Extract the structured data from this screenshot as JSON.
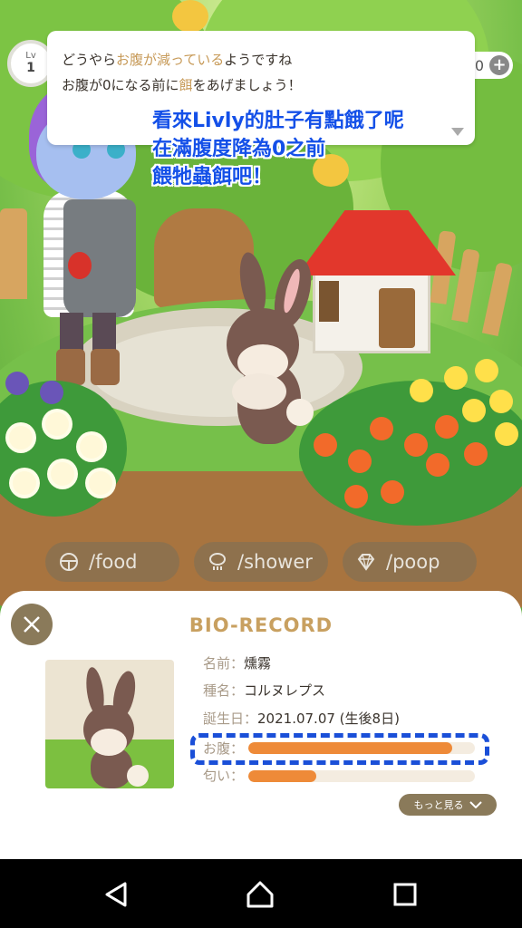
{
  "status": {
    "level_label": "Lv",
    "level_value": "1",
    "coins": "0",
    "add_label": "+"
  },
  "dialog": {
    "line1": {
      "a": "どうやら",
      "b": "お腹が減っている",
      "c": "ようですね"
    },
    "line2": {
      "a": "お腹が0になる前に",
      "b": "餌",
      "c": "をあげましょう！"
    }
  },
  "overlay_caption": {
    "line1": "看來Livly的肚子有點餓了呢",
    "line2": "在滿腹度降為0之前",
    "line3": "餵牠蟲餌吧！"
  },
  "actions": [
    {
      "label": "/food",
      "icon": "food-icon"
    },
    {
      "label": "/shower",
      "icon": "shower-icon"
    },
    {
      "label": "/poop",
      "icon": "poop-icon"
    }
  ],
  "bio_record": {
    "title": "BIO-RECORD",
    "name_key": "名前：",
    "name_value": "燻霧",
    "species_key": "種名：",
    "species_value": "コルヌレプス",
    "birthday_key": "誕生日：",
    "birthday_value": "2021.07.07 (生後8日)",
    "hunger_key": "お腹：",
    "hunger_level": 0.9,
    "smell_key": "匂い：",
    "smell_level": 0.3,
    "more_label": "もっと見る"
  },
  "colors": {
    "accent_brown": "#8a7a5a",
    "title_gold": "#c8a060",
    "bar_orange": "#ee8a38",
    "highlight_blue": "#1a4fd8"
  }
}
